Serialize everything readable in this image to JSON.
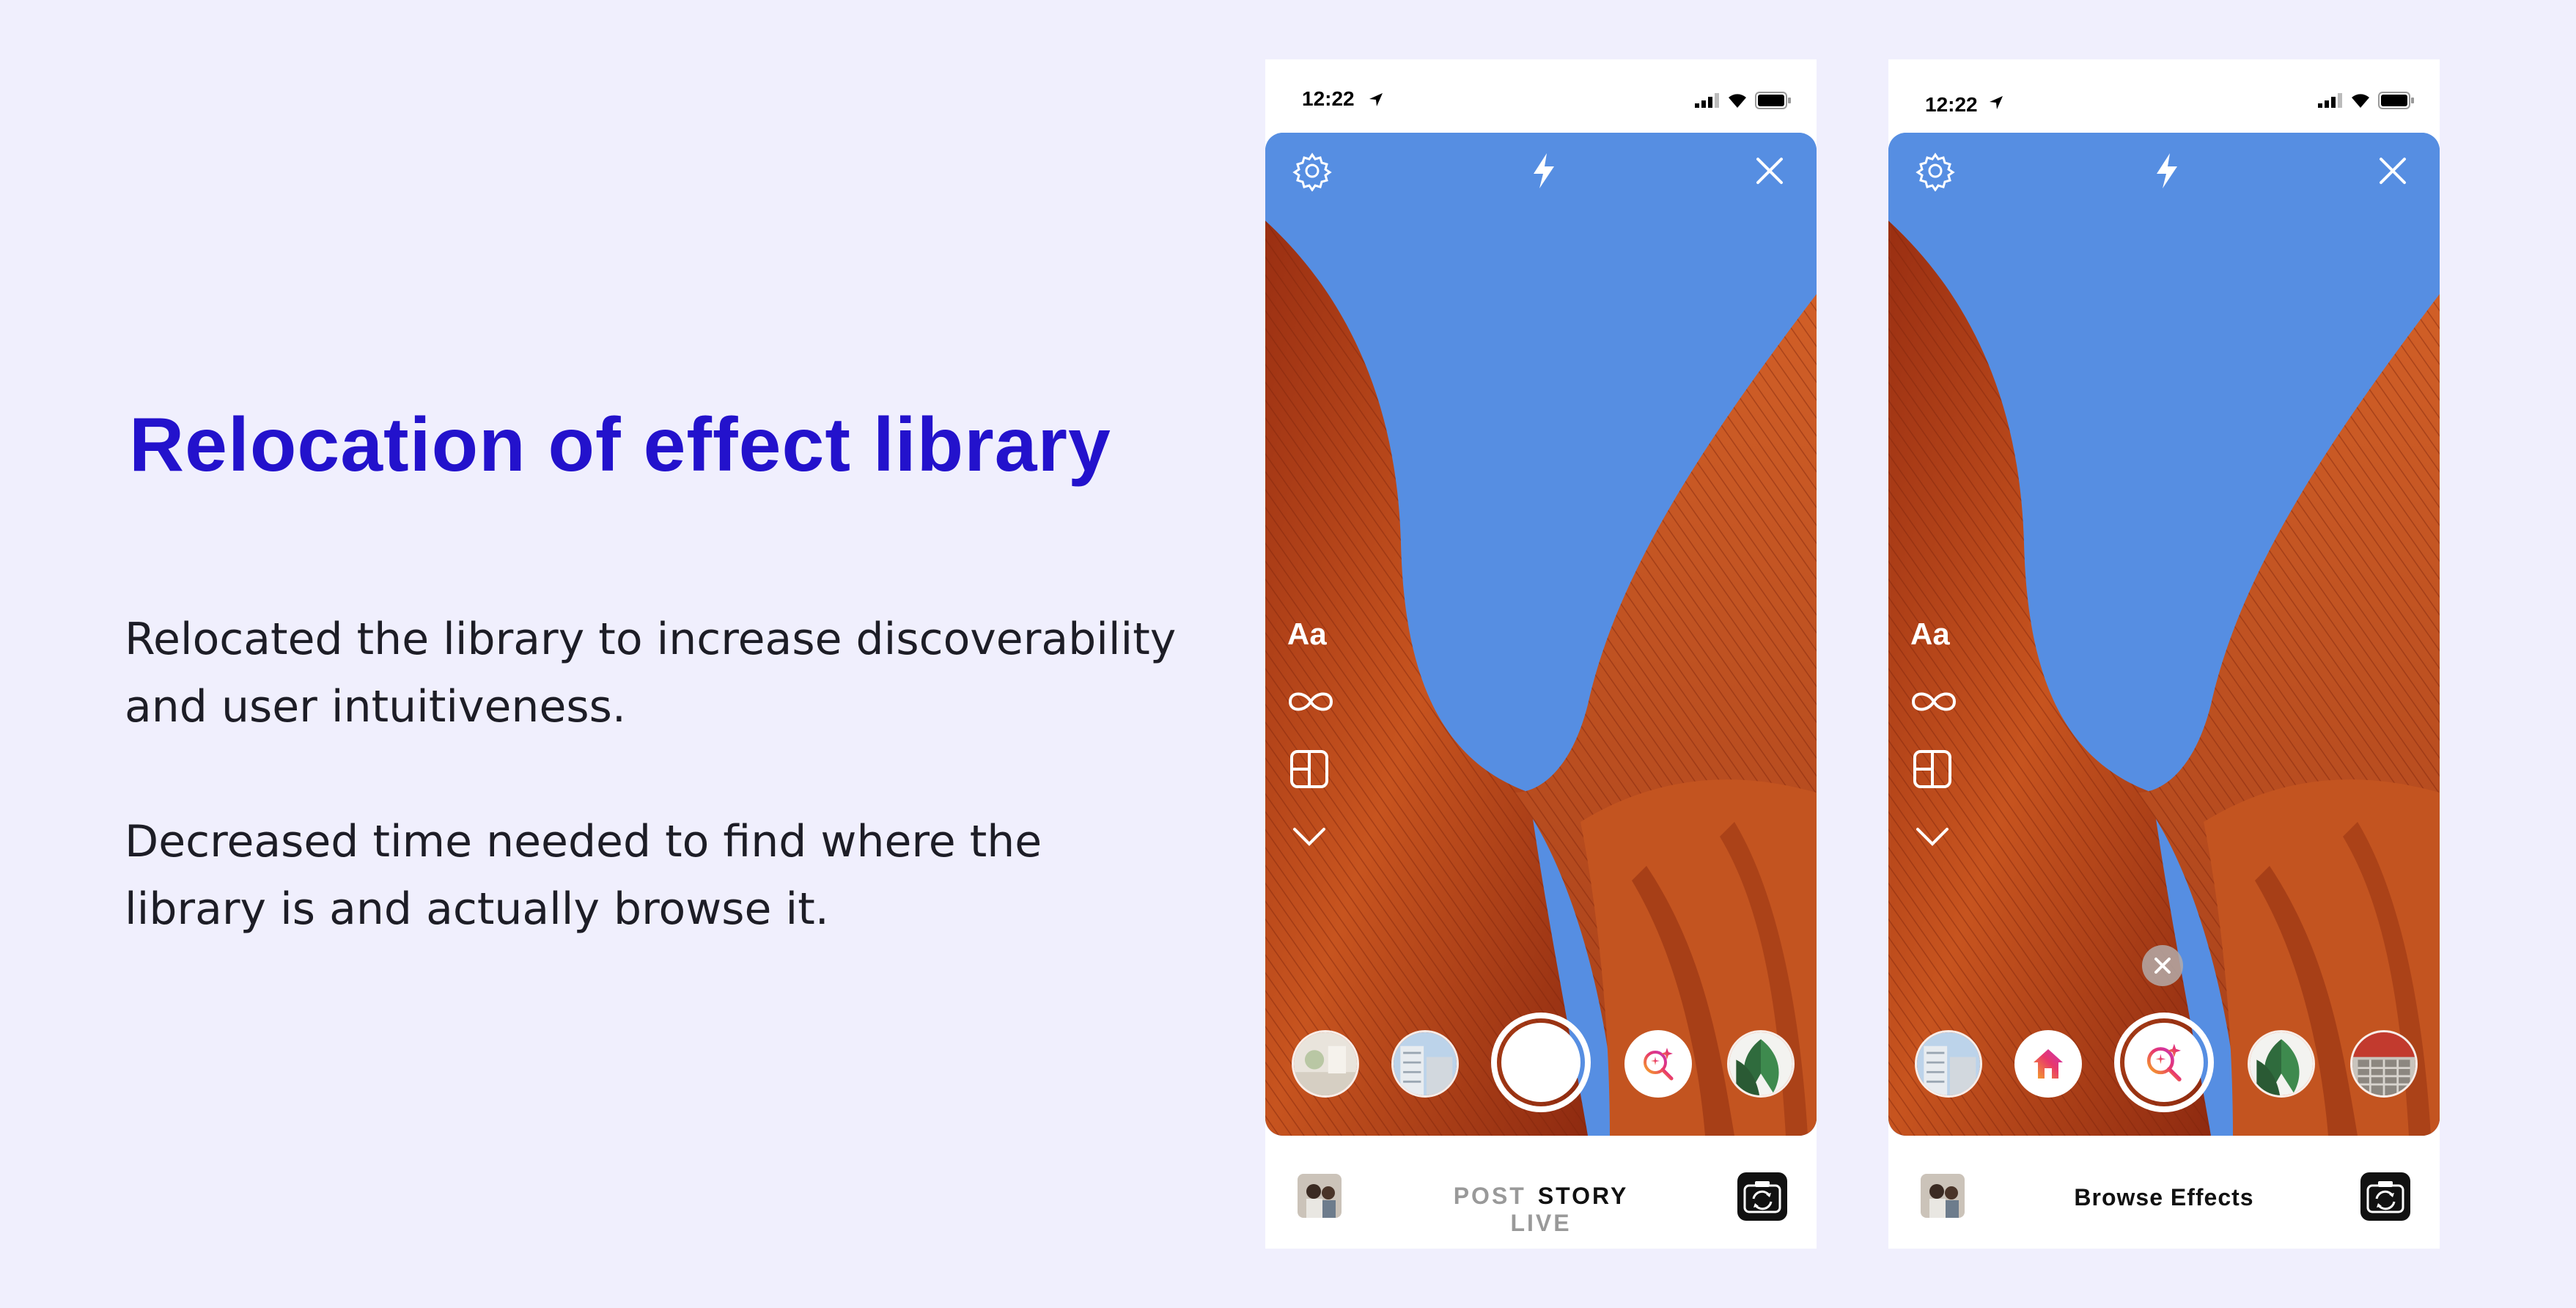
{
  "slide": {
    "title": "Relocation of effect library",
    "paragraph_1": "Relocated the library to increase discoverability and user intuitiveness.",
    "paragraph_2": "Decreased time needed to find where the library is and actually browse it."
  },
  "phone_before": {
    "status_time": "12:22",
    "text_tool_label": "Aa",
    "modes": [
      "POST",
      "STORY",
      "LIVE"
    ],
    "active_mode": "STORY"
  },
  "phone_after": {
    "status_time": "12:22",
    "text_tool_label": "Aa",
    "bottom_label": "Browse Effects"
  },
  "icons": {
    "settings": "gear-icon",
    "flash": "flash-icon",
    "close": "close-icon",
    "boomerang": "infinity-icon",
    "layout": "layout-icon",
    "expand": "chevron-down-icon",
    "browse_effects": "sparkle-search-icon",
    "home_effect": "home-icon",
    "flip_camera": "camera-flip-icon"
  },
  "colors": {
    "background": "#f0effd",
    "title": "#2312cc",
    "sky": "#568ee2",
    "facade": "#c3501f",
    "effect_gradient_start": "#f5a623",
    "effect_gradient_end": "#c832b8"
  }
}
